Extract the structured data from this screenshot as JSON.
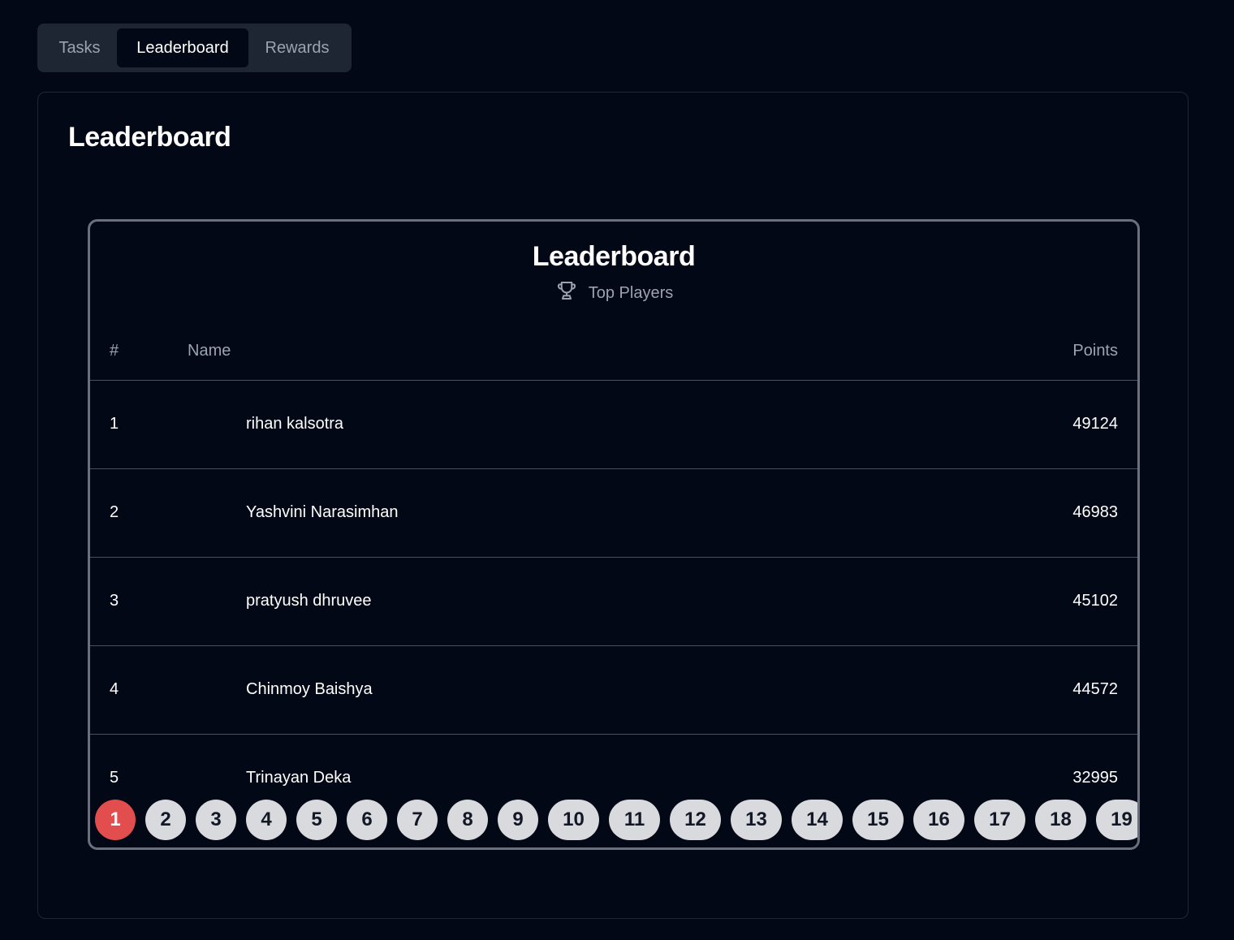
{
  "tabs": [
    {
      "label": "Tasks",
      "active": false
    },
    {
      "label": "Leaderboard",
      "active": true
    },
    {
      "label": "Rewards",
      "active": false
    }
  ],
  "card": {
    "title": "Leaderboard"
  },
  "board": {
    "title": "Leaderboard",
    "subtitle": "Top Players",
    "subtitle_icon": "trophy-icon",
    "columns": {
      "rank": "#",
      "name": "Name",
      "points": "Points"
    },
    "rows": [
      {
        "rank": "1",
        "name": "rihan kalsotra",
        "points": "49124"
      },
      {
        "rank": "2",
        "name": "Yashvini Narasimhan",
        "points": "46983"
      },
      {
        "rank": "3",
        "name": "pratyush dhruvee",
        "points": "45102"
      },
      {
        "rank": "4",
        "name": "Chinmoy Baishya",
        "points": "44572"
      },
      {
        "rank": "5",
        "name": "Trinayan Deka",
        "points": "32995"
      }
    ]
  },
  "pagination": {
    "current": "1",
    "pages": [
      "1",
      "2",
      "3",
      "4",
      "5",
      "6",
      "7",
      "8",
      "9",
      "10",
      "11",
      "12",
      "13",
      "14",
      "15",
      "16",
      "17",
      "18",
      "19"
    ]
  },
  "colors": {
    "background": "#030816",
    "tab_bar": "#1e2533",
    "active_page": "#e24d4d",
    "page_button": "#d9dadd",
    "muted_text": "#9aa3b2"
  }
}
